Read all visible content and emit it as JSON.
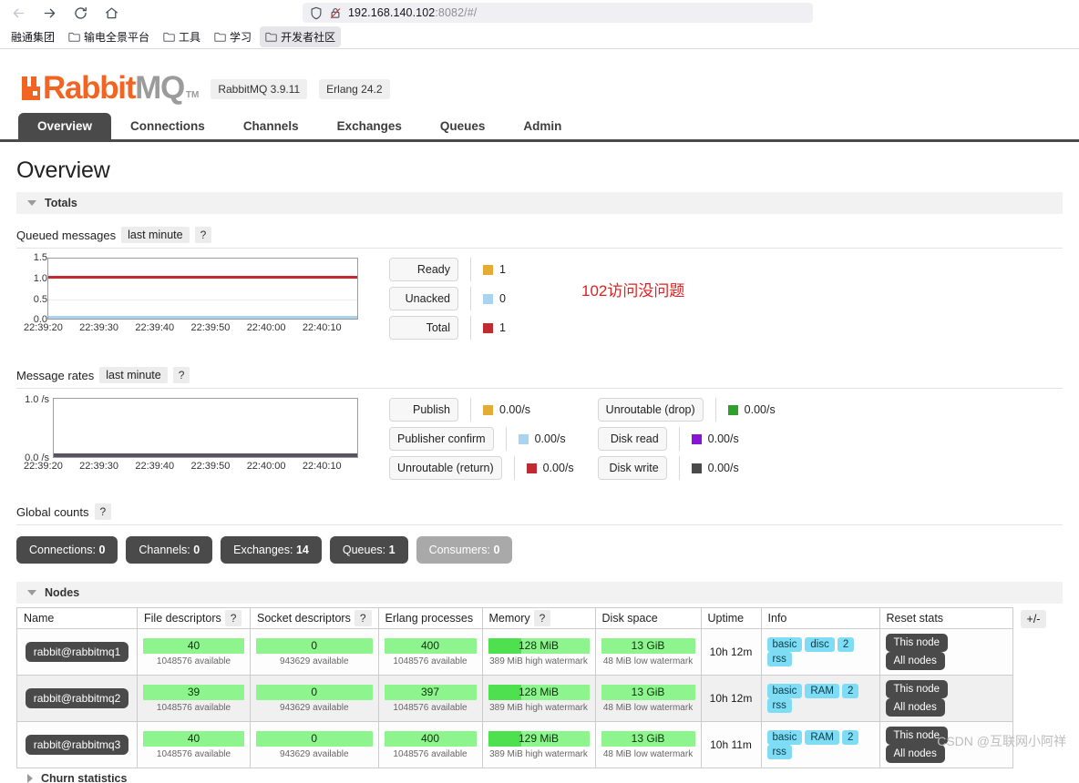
{
  "browser": {
    "nav": {
      "back_icon": "back-arrow-icon",
      "forward_icon": "forward-arrow-icon",
      "reload_icon": "reload-icon",
      "home_icon": "home-icon"
    },
    "url": {
      "host": "192.168.140.102",
      "rest": ":8082/#/",
      "shield_icon": "shield-icon",
      "lock_off_icon": "lock-disabled-icon"
    },
    "bookmarks": [
      {
        "label": "融通集团",
        "has_folder": false,
        "active": false
      },
      {
        "label": "输电全景平台",
        "has_folder": true,
        "active": false
      },
      {
        "label": "工具",
        "has_folder": true,
        "active": false
      },
      {
        "label": "学习",
        "has_folder": true,
        "active": false
      },
      {
        "label": "开发者社区",
        "has_folder": true,
        "active": true
      }
    ]
  },
  "app": {
    "logo_rabbit": "Rabbit",
    "logo_mq": "MQ",
    "logo_tm": "TM",
    "version_pill": "RabbitMQ 3.9.11",
    "erlang_pill": "Erlang 24.2",
    "tabs": [
      {
        "label": "Overview",
        "active": true
      },
      {
        "label": "Connections",
        "active": false
      },
      {
        "label": "Channels",
        "active": false
      },
      {
        "label": "Exchanges",
        "active": false
      },
      {
        "label": "Queues",
        "active": false
      },
      {
        "label": "Admin",
        "active": false
      }
    ],
    "page_title": "Overview",
    "totals_section": "Totals",
    "nodes_section": "Nodes",
    "churn_section": "Churn statistics"
  },
  "annotation": "102访问没问题",
  "watermark": "CSDN @互联网小阿祥",
  "queued": {
    "title": "Queued messages",
    "period": "last minute",
    "help": "?",
    "legend": [
      {
        "label": "Ready",
        "value": "1",
        "color": "#e5ac33"
      },
      {
        "label": "Unacked",
        "value": "0",
        "color": "#a8d4f0"
      },
      {
        "label": "Total",
        "value": "1",
        "color": "#c02a30"
      }
    ]
  },
  "rates": {
    "title": "Message rates",
    "period": "last minute",
    "help": "?",
    "legend_left": [
      {
        "label": "Publish",
        "value": "0.00/s",
        "color": "#e5ac33"
      },
      {
        "label": "Publisher confirm",
        "value": "0.00/s",
        "color": "#a8d4f0"
      },
      {
        "label": "Unroutable (return)",
        "value": "0.00/s",
        "color": "#c02a30"
      }
    ],
    "legend_right": [
      {
        "label": "Unroutable (drop)",
        "value": "0.00/s",
        "color": "#2da02d"
      },
      {
        "label": "Disk read",
        "value": "0.00/s",
        "color": "#8b13d6"
      },
      {
        "label": "Disk write",
        "value": "0.00/s",
        "color": "#4a4a4a"
      }
    ]
  },
  "global_counts": {
    "title": "Global counts",
    "help": "?",
    "items": [
      {
        "label": "Connections:",
        "value": "0",
        "muted": false
      },
      {
        "label": "Channels:",
        "value": "0",
        "muted": false
      },
      {
        "label": "Exchanges:",
        "value": "14",
        "muted": false
      },
      {
        "label": "Queues:",
        "value": "1",
        "muted": false
      },
      {
        "label": "Consumers:",
        "value": "0",
        "muted": true
      }
    ]
  },
  "nodes_table": {
    "headers": [
      {
        "label": "Name",
        "help": ""
      },
      {
        "label": "File descriptors",
        "help": "?"
      },
      {
        "label": "Socket descriptors",
        "help": "?"
      },
      {
        "label": "Erlang processes",
        "help": ""
      },
      {
        "label": "Memory",
        "help": "?"
      },
      {
        "label": "Disk space",
        "help": ""
      },
      {
        "label": "Uptime",
        "help": ""
      },
      {
        "label": "Info",
        "help": ""
      },
      {
        "label": "Reset stats",
        "help": ""
      }
    ],
    "plusminus": "+/-",
    "rows": [
      {
        "name": "rabbit@rabbitmq1",
        "fd": "40",
        "fd_note": "1048576 available",
        "fd_pct": 0,
        "sd": "0",
        "sd_note": "943629 available",
        "sd_pct": 0,
        "proc": "400",
        "proc_note": "1048576 available",
        "proc_pct": 0,
        "mem": "128 MiB",
        "mem_note": "389 MiB high watermark",
        "mem_pct": 33,
        "disk": "13 GiB",
        "disk_note": "48 MiB low watermark",
        "disk_pct": 0,
        "uptime": "10h 12m",
        "info": [
          "basic",
          "disc",
          "2",
          "rss"
        ],
        "reset": [
          "This node",
          "All nodes"
        ]
      },
      {
        "name": "rabbit@rabbitmq2",
        "fd": "39",
        "fd_note": "1048576 available",
        "fd_pct": 0,
        "sd": "0",
        "sd_note": "943629 available",
        "sd_pct": 0,
        "proc": "397",
        "proc_note": "1048576 available",
        "proc_pct": 0,
        "mem": "128 MiB",
        "mem_note": "389 MiB high watermark",
        "mem_pct": 33,
        "disk": "13 GiB",
        "disk_note": "48 MiB low watermark",
        "disk_pct": 0,
        "uptime": "10h 12m",
        "info": [
          "basic",
          "RAM",
          "2",
          "rss"
        ],
        "reset": [
          "This node",
          "All nodes"
        ]
      },
      {
        "name": "rabbit@rabbitmq3",
        "fd": "40",
        "fd_note": "1048576 available",
        "fd_pct": 0,
        "sd": "0",
        "sd_note": "943629 available",
        "sd_pct": 0,
        "proc": "400",
        "proc_note": "1048576 available",
        "proc_pct": 0,
        "mem": "129 MiB",
        "mem_note": "389 MiB high watermark",
        "mem_pct": 33,
        "disk": "13 GiB",
        "disk_note": "48 MiB low watermark",
        "disk_pct": 0,
        "uptime": "10h 11m",
        "info": [
          "basic",
          "RAM",
          "2",
          "rss"
        ],
        "reset": [
          "This node",
          "All nodes"
        ]
      }
    ]
  },
  "chart_data": [
    {
      "type": "line",
      "title": "Queued messages",
      "subtitle": "last minute",
      "xlabel": "",
      "ylabel": "",
      "ylim": [
        0.0,
        1.5
      ],
      "yticks": [
        "0.0",
        "0.5",
        "1.0",
        "1.5"
      ],
      "x": [
        "22:39:20",
        "22:39:30",
        "22:39:40",
        "22:39:50",
        "22:40:00",
        "22:40:10"
      ],
      "grid": true,
      "legend_position": "right",
      "series": [
        {
          "name": "Ready",
          "color": "#e5ac33",
          "values": [
            1,
            1,
            1,
            1,
            1,
            1
          ],
          "current": 1
        },
        {
          "name": "Unacked",
          "color": "#a8d4f0",
          "values": [
            0,
            0,
            0,
            0,
            0,
            0
          ],
          "current": 0
        },
        {
          "name": "Total",
          "color": "#c02a30",
          "values": [
            1,
            1,
            1,
            1,
            1,
            1
          ],
          "current": 1
        }
      ]
    },
    {
      "type": "line",
      "title": "Message rates",
      "subtitle": "last minute",
      "xlabel": "",
      "ylabel": "/s",
      "ylim": [
        0.0,
        1.0
      ],
      "yticks": [
        "0.0 /s",
        "1.0 /s"
      ],
      "x": [
        "22:39:20",
        "22:39:30",
        "22:39:40",
        "22:39:50",
        "22:40:00",
        "22:40:10"
      ],
      "grid": false,
      "legend_position": "right",
      "series": [
        {
          "name": "Publish",
          "color": "#e5ac33",
          "values": [
            0,
            0,
            0,
            0,
            0,
            0
          ],
          "current": "0.00/s"
        },
        {
          "name": "Publisher confirm",
          "color": "#a8d4f0",
          "values": [
            0,
            0,
            0,
            0,
            0,
            0
          ],
          "current": "0.00/s"
        },
        {
          "name": "Unroutable (return)",
          "color": "#c02a30",
          "values": [
            0,
            0,
            0,
            0,
            0,
            0
          ],
          "current": "0.00/s"
        },
        {
          "name": "Unroutable (drop)",
          "color": "#2da02d",
          "values": [
            0,
            0,
            0,
            0,
            0,
            0
          ],
          "current": "0.00/s"
        },
        {
          "name": "Disk read",
          "color": "#8b13d6",
          "values": [
            0,
            0,
            0,
            0,
            0,
            0
          ],
          "current": "0.00/s"
        },
        {
          "name": "Disk write",
          "color": "#4a4a4a",
          "values": [
            0,
            0,
            0,
            0,
            0,
            0
          ],
          "current": "0.00/s"
        }
      ]
    }
  ]
}
